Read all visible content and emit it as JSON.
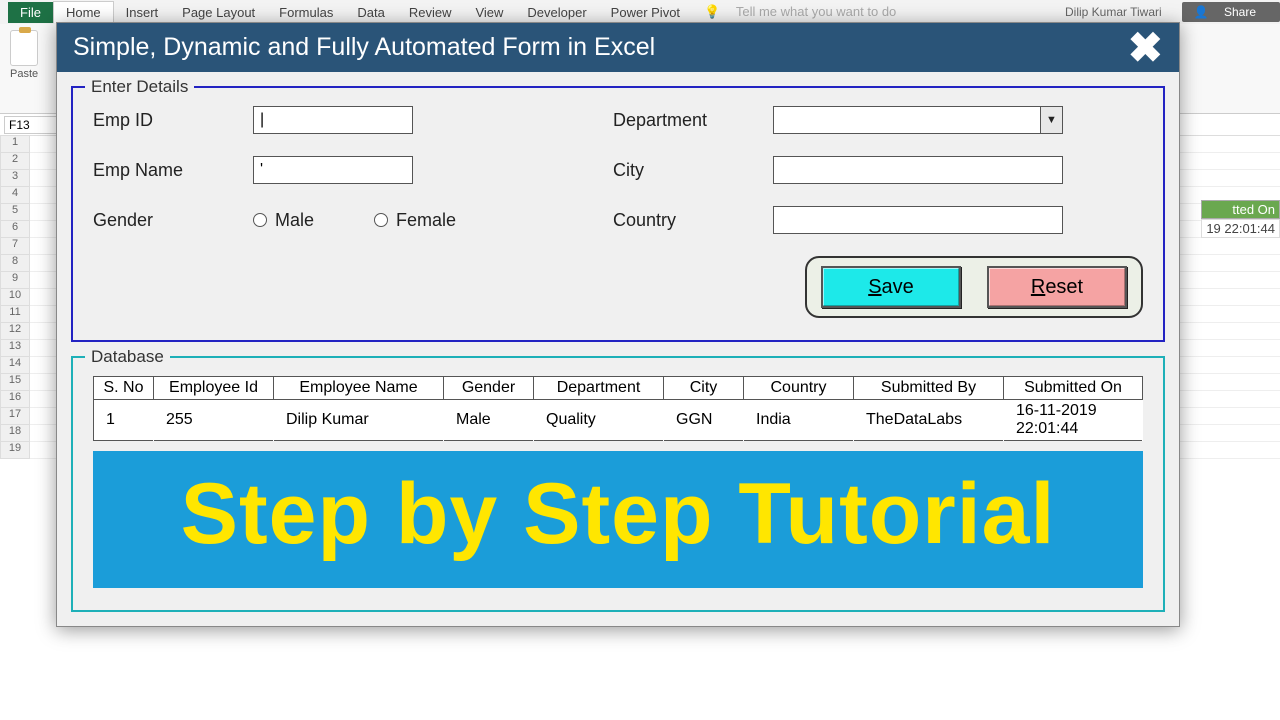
{
  "ribbon": {
    "file": "File",
    "tabs": [
      "Home",
      "Insert",
      "Page Layout",
      "Formulas",
      "Data",
      "Review",
      "View",
      "Developer",
      "Power Pivot"
    ],
    "tellme": "Tell me what you want to do",
    "user": "Dilip Kumar Tiwari",
    "share": "Share",
    "paste": "Paste"
  },
  "namebox": "F13",
  "rows": [
    "1",
    "2",
    "3",
    "4",
    "5",
    "6",
    "7",
    "8",
    "9",
    "10",
    "11",
    "12",
    "13",
    "14",
    "15",
    "16",
    "17",
    "18",
    "19"
  ],
  "dialog": {
    "title": "Simple, Dynamic and Fully Automated Form in Excel",
    "enter_legend": "Enter Details",
    "labels": {
      "empid": "Emp ID",
      "empname": "Emp Name",
      "gender": "Gender",
      "male": "Male",
      "female": "Female",
      "department": "Department",
      "city": "City",
      "country": "Country"
    },
    "values": {
      "empid": "|",
      "empname": "'"
    },
    "buttons": {
      "save": "Save",
      "reset": "Reset"
    },
    "db_legend": "Database",
    "db_headers": [
      "S. No",
      "Employee Id",
      "Employee Name",
      "Gender",
      "Department",
      "City",
      "Country",
      "Submitted By",
      "Submitted On"
    ],
    "db_row": [
      "1",
      "255",
      "Dilip Kumar",
      "Male",
      "Quality",
      "GGN",
      "India",
      "TheDataLabs",
      "16-11-2019 22:01:44"
    ],
    "banner": "Step by Step Tutorial"
  },
  "peek": {
    "h1": "tted On",
    "v1": "19 22:01:44"
  }
}
